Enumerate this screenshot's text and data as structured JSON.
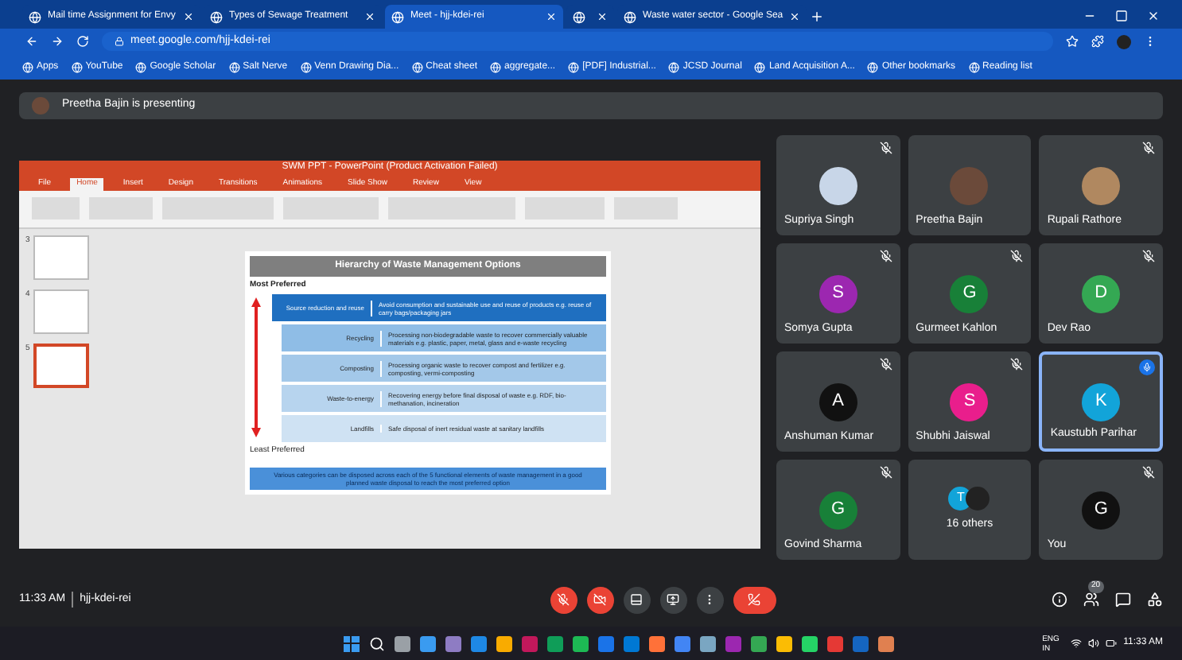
{
  "browser": {
    "tabs": [
      {
        "title": "Mail time Assignment for Envy",
        "selected": false
      },
      {
        "title": "Types of Sewage Treatment",
        "selected": false
      },
      {
        "title": "Meet - hjj-kdei-rei",
        "selected": true
      },
      {
        "selected": false
      },
      {
        "title": "Waste water sector - Google Sea",
        "selected": false
      }
    ],
    "url": "meet.google.com/hjj-kdei-rei",
    "bookmarks": [
      "Apps",
      "YouTube",
      "Google Scholar",
      "Salt Nerve",
      "Venn Drawing Dia...",
      "Cheat sheet",
      "aggregate...",
      "[PDF] Industrial...",
      "JCSD Journal",
      "Land Acquisition A...",
      "Other bookmarks",
      "Reading list"
    ]
  },
  "presenting_banner": "Preetha Bajin is presenting",
  "slide_app": {
    "title": "SWM PPT - PowerPoint (Product Activation Failed)",
    "ribbon_tabs": [
      {
        "label": "File",
        "selected": false
      },
      {
        "label": "Home",
        "selected": true
      },
      {
        "label": "Insert",
        "selected": false
      },
      {
        "label": "Design",
        "selected": false
      },
      {
        "label": "Transitions",
        "selected": false
      },
      {
        "label": "Animations",
        "selected": false
      },
      {
        "label": "Slide Show",
        "selected": false
      },
      {
        "label": "Review",
        "selected": false
      },
      {
        "label": "View",
        "selected": false
      }
    ],
    "thumbnails": [
      {
        "number": "3",
        "selected": false
      },
      {
        "number": "4",
        "selected": false
      },
      {
        "number": "5",
        "selected": true
      }
    ],
    "slide": {
      "title": "Hierarchy of Waste Management Options",
      "top_label": "Most Preferred",
      "bottom_label": "Least Preferred",
      "rows": [
        {
          "option": "Source reduction and reuse",
          "description": "Avoid consumption and sustainable use and reuse of products e.g. reuse of carry bags/packaging jars",
          "color": "#1f6fc0"
        },
        {
          "option": "Recycling",
          "description": "Processing non-biodegradable waste to recover commercially valuable materials e.g. plastic, paper, metal, glass and e-waste recycling",
          "color": "#8fbde6"
        },
        {
          "option": "Composting",
          "description": "Processing organic waste to recover compost and fertilizer e.g. composting, vermi-composting",
          "color": "#a3c8e9"
        },
        {
          "option": "Waste-to-energy",
          "description": "Recovering energy before final disposal of waste e.g. RDF, bio-methanation, incineration",
          "color": "#b7d4ee"
        },
        {
          "option": "Landfills",
          "description": "Safe disposal of inert residual waste at sanitary landfills",
          "color": "#cfe2f3"
        }
      ],
      "footer": "Various categories can be disposed across each of the 5 functional elements of waste management in a good planned waste disposal to reach the most preferred option"
    }
  },
  "participants": [
    {
      "name": "Supriya Singh",
      "kind": "photo",
      "color": "#c8d6e8",
      "muted": true,
      "speaking": false
    },
    {
      "name": "Preetha Bajin",
      "kind": "photo",
      "color": "#6b4a3a",
      "muted": false,
      "speaking": false
    },
    {
      "name": "Rupali Rathore",
      "kind": "photo",
      "color": "#b08860",
      "muted": true,
      "speaking": false
    },
    {
      "name": "Somya Gupta",
      "kind": "initial",
      "letter": "S",
      "color": "#9c27b0",
      "muted": true,
      "speaking": false
    },
    {
      "name": "Gurmeet Kahlon",
      "kind": "initial",
      "letter": "G",
      "color": "#188038",
      "muted": true,
      "speaking": false
    },
    {
      "name": "Dev Rao",
      "kind": "initial",
      "letter": "D",
      "color": "#34a853",
      "muted": true,
      "speaking": false
    },
    {
      "name": "Anshuman Kumar",
      "kind": "initial",
      "letter": "A",
      "color": "#111111",
      "muted": true,
      "speaking": false
    },
    {
      "name": "Shubhi Jaiswal",
      "kind": "initial",
      "letter": "S",
      "color": "#e91e8c",
      "muted": true,
      "speaking": false
    },
    {
      "name": "Kaustubh Parihar",
      "kind": "initial",
      "letter": "K",
      "color": "#12a4d9",
      "muted": false,
      "speaking": true
    },
    {
      "name": "Govind Sharma",
      "kind": "initial",
      "letter": "G",
      "color": "#188038",
      "muted": true,
      "speaking": false
    },
    {
      "name": "16 others",
      "kind": "group",
      "letter": "T",
      "color": "#12a4d9",
      "muted": false,
      "speaking": false
    },
    {
      "name": "You",
      "kind": "initial",
      "letter": "G",
      "color": "#111111",
      "muted": true,
      "speaking": false
    }
  ],
  "meeting_bar": {
    "time": "11:33 AM",
    "code": "hjj-kdei-rei",
    "participant_count": "20"
  },
  "taskbar": {
    "language": "ENG IN",
    "clock": "11:33 AM"
  }
}
